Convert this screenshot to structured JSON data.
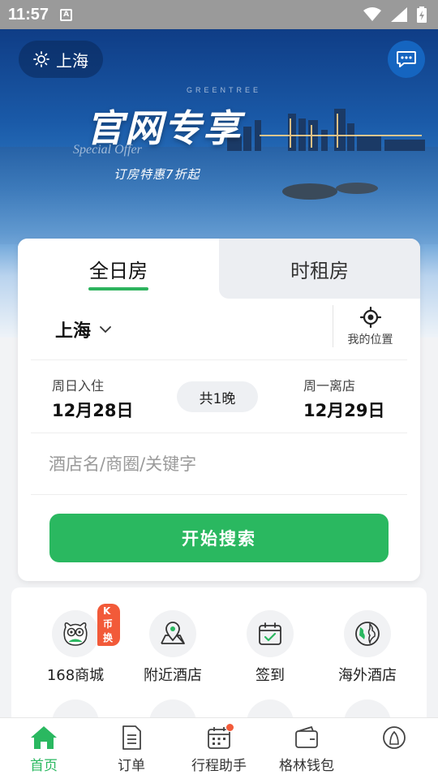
{
  "status_bar": {
    "time": "11:57",
    "notification_icon": "A"
  },
  "header": {
    "city": "上海",
    "city_icon": "sun-icon",
    "message_icon": "chat-icon"
  },
  "banner": {
    "small_text": "GREENTREE",
    "title": "官网专享",
    "script_text": "Special Offer",
    "subtitle": "订房特惠7折起"
  },
  "booking": {
    "tabs": [
      {
        "label": "全日房",
        "active": true
      },
      {
        "label": "时租房",
        "active": false
      }
    ],
    "city": "上海",
    "my_location_label": "我的位置",
    "checkin_label": "周日入住",
    "checkin_date": "12月28日",
    "nights": "共1晚",
    "checkout_label": "周一离店",
    "checkout_date": "12月29日",
    "search_placeholder": "酒店名/商圈/关键字",
    "search_button": "开始搜索"
  },
  "quick_menu": [
    {
      "label": "168商城",
      "icon": "owl-mall-icon",
      "badge": "K币换"
    },
    {
      "label": "附近酒店",
      "icon": "map-pin-icon"
    },
    {
      "label": "签到",
      "icon": "calendar-check-icon"
    },
    {
      "label": "海外酒店",
      "icon": "globe-icon"
    }
  ],
  "bottom_nav": [
    {
      "label": "首页",
      "icon": "home-icon",
      "active": true
    },
    {
      "label": "订单",
      "icon": "order-list-icon"
    },
    {
      "label": "行程助手",
      "icon": "itinerary-calendar-icon",
      "dot": true
    },
    {
      "label": "格林钱包",
      "icon": "wallet-icon"
    },
    {
      "label": "",
      "icon": "profile-icon"
    }
  ],
  "colors": {
    "accent": "#2ab860",
    "badge": "#f25a39",
    "chat_button": "#1565c0"
  }
}
